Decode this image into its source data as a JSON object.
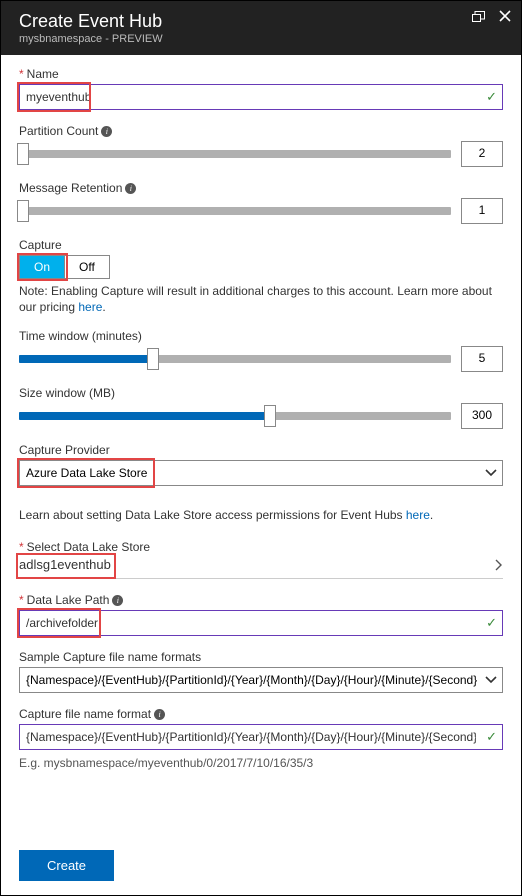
{
  "header": {
    "title": "Create Event Hub",
    "subtitle": "mysbnamespace - PREVIEW"
  },
  "name": {
    "label": "Name",
    "value": "myeventhub"
  },
  "partitionCount": {
    "label": "Partition Count",
    "value": "2",
    "min": 2,
    "max": 32,
    "fillPercent": 1
  },
  "messageRetention": {
    "label": "Message Retention",
    "value": "1",
    "min": 1,
    "max": 7,
    "fillPercent": 1
  },
  "capture": {
    "label": "Capture",
    "on": "On",
    "off": "Off",
    "note_prefix": "Note: Enabling Capture will result in additional charges to this account. Learn more about our pricing ",
    "note_link": "here",
    "note_suffix": "."
  },
  "timeWindow": {
    "label": "Time window (minutes)",
    "value": "5",
    "fillPercent": 31
  },
  "sizeWindow": {
    "label": "Size window (MB)",
    "value": "300",
    "fillPercent": 58
  },
  "captureProvider": {
    "label": "Capture Provider",
    "value": "Azure Data Lake Store"
  },
  "adlsLearn": {
    "prefix": "Learn about setting Data Lake Store access permissions for Event Hubs ",
    "link": "here",
    "suffix": "."
  },
  "selectAdls": {
    "label": "Select Data Lake Store",
    "value": "adlsg1eventhub"
  },
  "dataLakePath": {
    "label": "Data Lake Path",
    "value": "/archivefolder"
  },
  "sampleFormats": {
    "label": "Sample Capture file name formats",
    "value": "{Namespace}/{EventHub}/{PartitionId}/{Year}/{Month}/{Day}/{Hour}/{Minute}/{Second}"
  },
  "captureFormat": {
    "label": "Capture file name format",
    "value": "{Namespace}/{EventHub}/{PartitionId}/{Year}/{Month}/{Day}/{Hour}/{Minute}/{Second}"
  },
  "example": "E.g. mysbnamespace/myeventhub/0/2017/7/10/16/35/3",
  "createBtn": "Create"
}
